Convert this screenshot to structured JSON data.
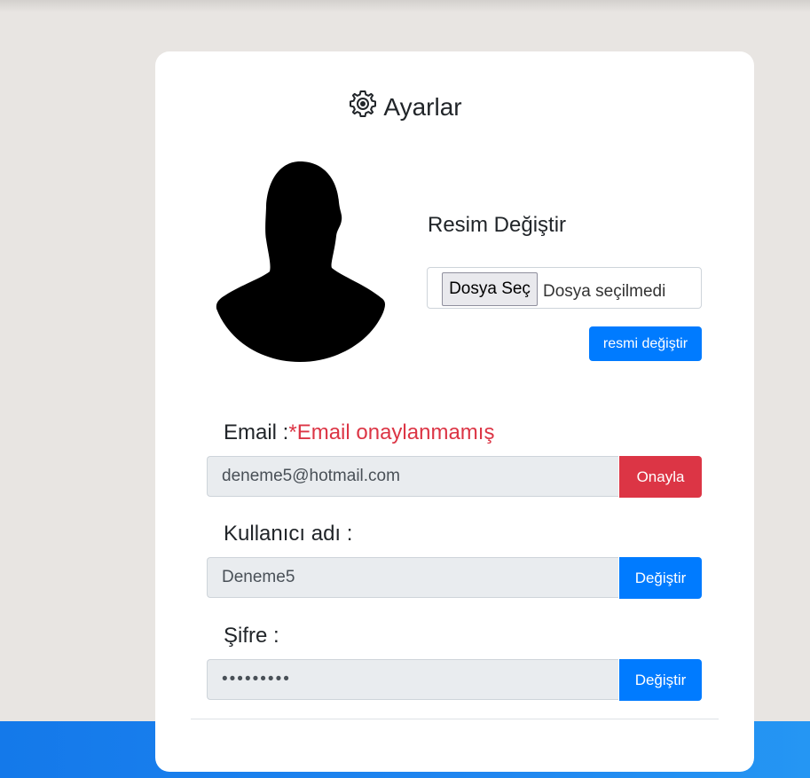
{
  "header": {
    "title": "Ayarlar",
    "icon": "gear-icon"
  },
  "avatar": {
    "icon": "user-silhouette-icon"
  },
  "photo": {
    "label": "Resim Değiştir",
    "file_button": "Dosya Seç",
    "file_status": "Dosya seçilmedi",
    "submit_label": "resmi değiştir"
  },
  "email": {
    "label": "Email :",
    "warning": "*Email onaylanmamış",
    "value": "deneme5@hotmail.com",
    "button": "Onayla"
  },
  "username": {
    "label": "Kullanıcı adı :",
    "value": "Deneme5",
    "button": "Değiştir"
  },
  "password": {
    "label": "Şifre :",
    "value": "•••••••••",
    "button": "Değiştir"
  },
  "colors": {
    "primary": "#007bff",
    "danger": "#dc3545",
    "accent_band": "#1479ea"
  }
}
